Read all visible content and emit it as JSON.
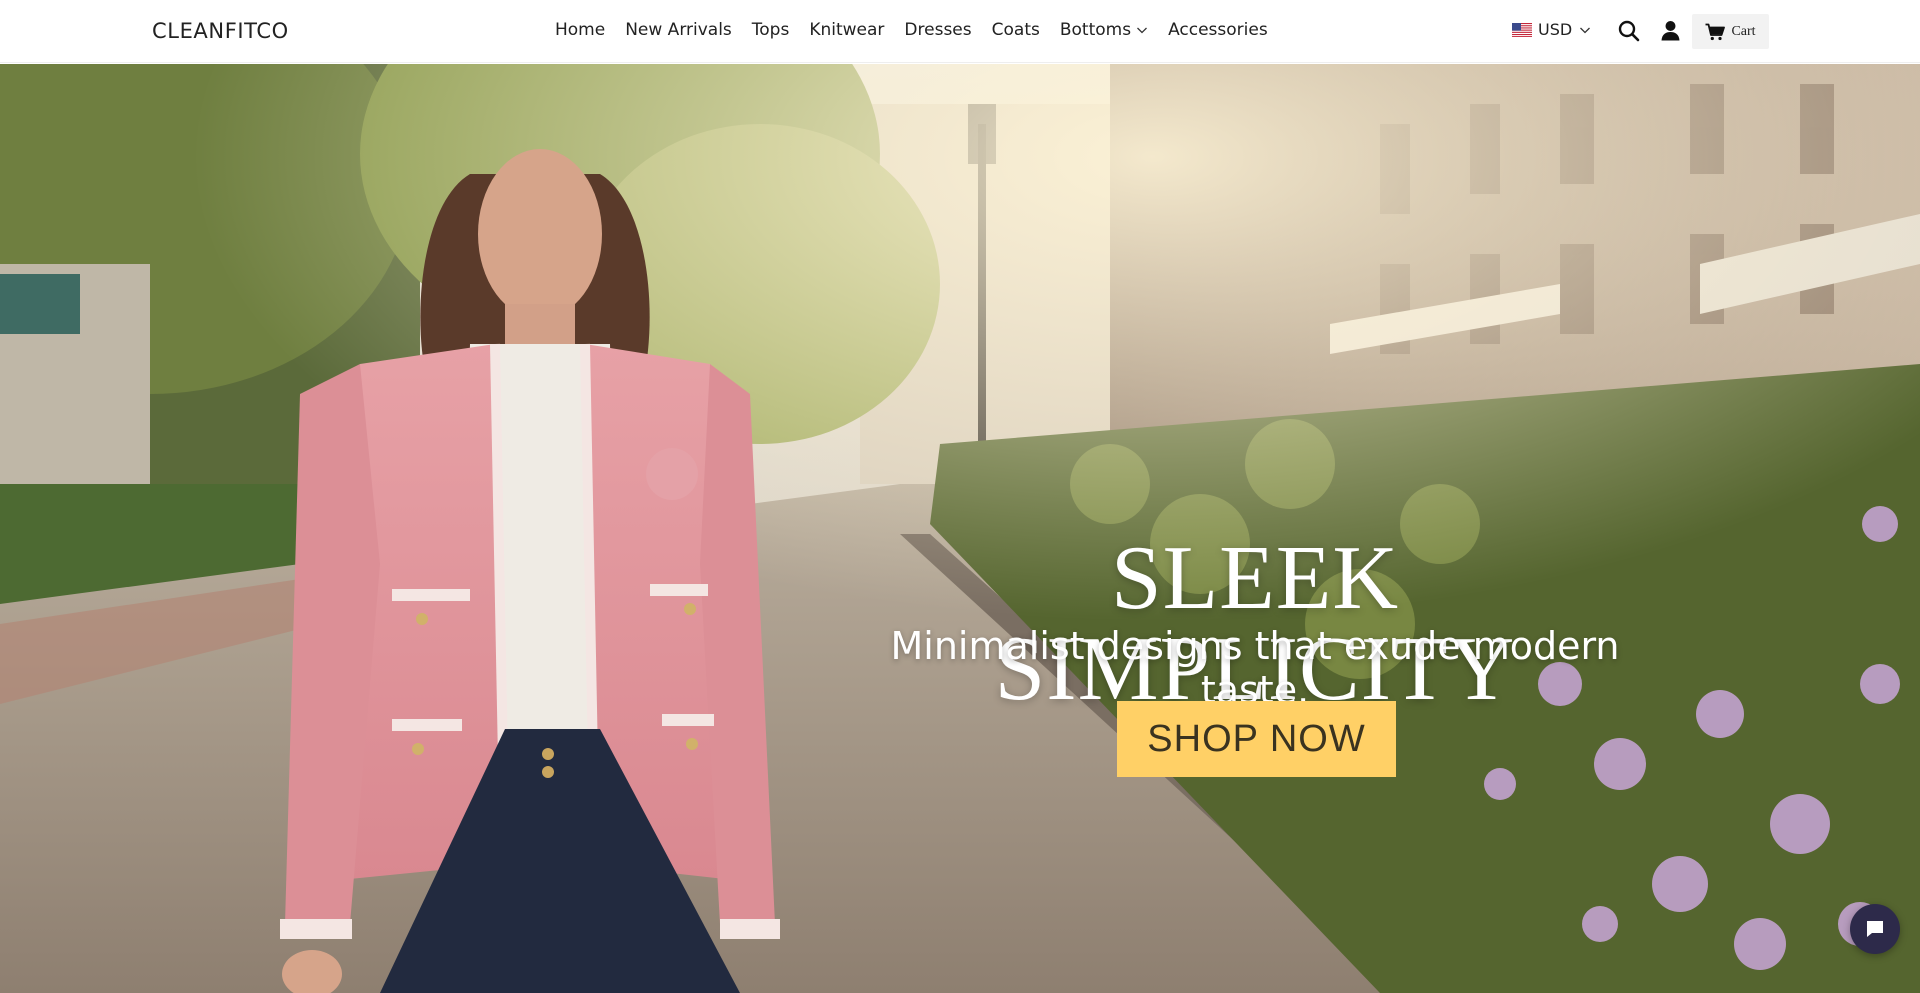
{
  "header": {
    "logo": "CLEANFITCO",
    "nav": [
      {
        "label": "Home"
      },
      {
        "label": "New Arrivals"
      },
      {
        "label": "Tops"
      },
      {
        "label": "Knitwear"
      },
      {
        "label": "Dresses"
      },
      {
        "label": "Coats"
      },
      {
        "label": "Bottoms",
        "has_dropdown": true
      },
      {
        "label": "Accessories"
      }
    ],
    "currency": {
      "label": "USD",
      "flag": "us-flag-icon"
    },
    "search_icon": "search-icon",
    "account_icon": "user-icon",
    "cart": {
      "label": "Cart",
      "icon": "cart-icon"
    }
  },
  "hero": {
    "title": "SLEEK SIMPLICITY",
    "subtitle": "Minimalist designs that exude modern taste.",
    "cta": "SHOP NOW",
    "cta_color": "#ffd066"
  },
  "chat": {
    "icon": "chat-icon",
    "color": "#2d2a4a"
  }
}
